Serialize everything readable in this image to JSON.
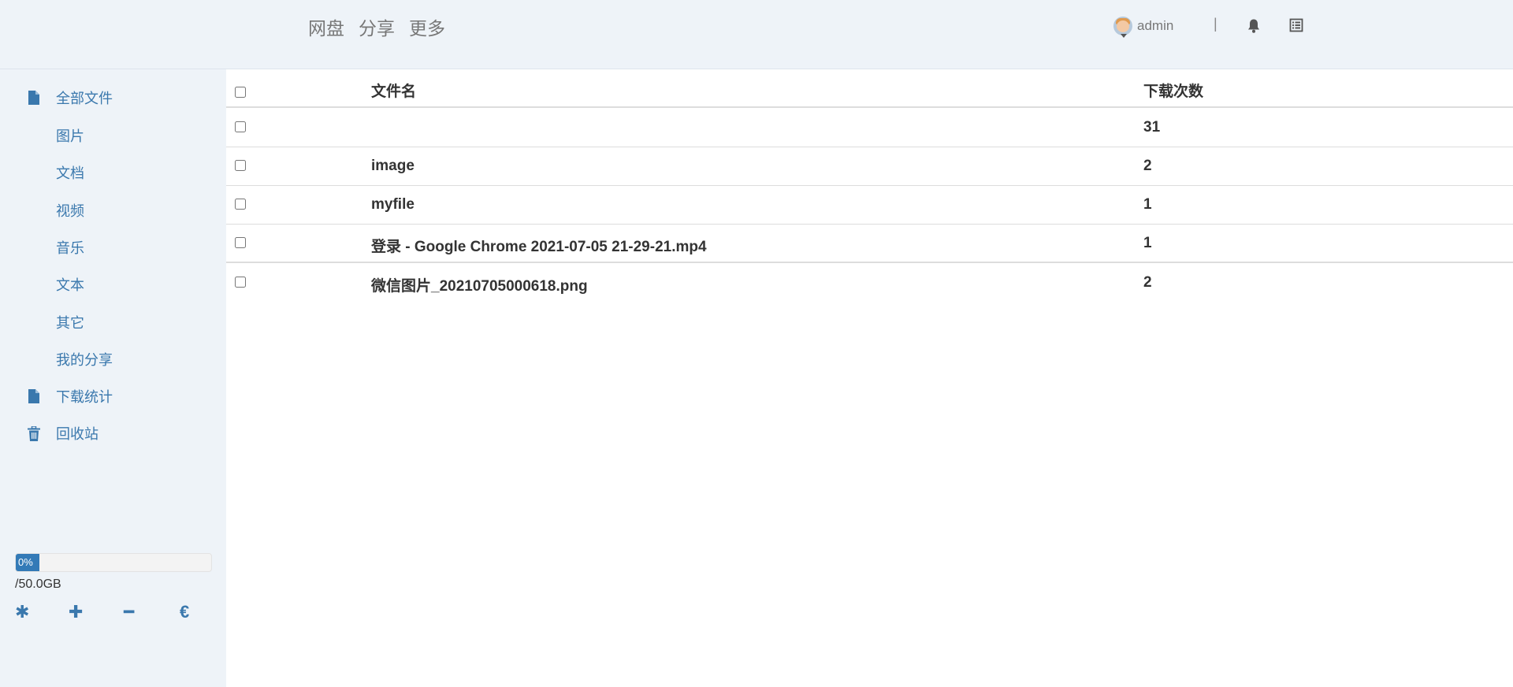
{
  "topnav": {
    "items": [
      "网盘",
      "分享",
      "更多"
    ]
  },
  "user": {
    "name": "admin",
    "separator": "|",
    "icons": [
      "avatar",
      "bell-icon",
      "list-icon"
    ]
  },
  "sidebar": {
    "items": [
      {
        "label": "全部文件",
        "icon": "file-icon"
      },
      {
        "label": "图片",
        "icon": ""
      },
      {
        "label": "文档",
        "icon": ""
      },
      {
        "label": "视频",
        "icon": ""
      },
      {
        "label": "音乐",
        "icon": ""
      },
      {
        "label": "文本",
        "icon": ""
      },
      {
        "label": "其它",
        "icon": ""
      },
      {
        "label": "我的分享",
        "icon": ""
      },
      {
        "label": "下载统计",
        "icon": "file-icon"
      },
      {
        "label": "回收站",
        "icon": "trash-icon"
      }
    ],
    "storage": {
      "percent_label": "0%",
      "used_fraction": 0,
      "quota_text": "/50.0GB"
    },
    "tools": [
      {
        "glyph": "✱",
        "icon": "asterisk-icon"
      },
      {
        "glyph": "✚",
        "icon": "plus-icon"
      },
      {
        "glyph": "━",
        "icon": "minus-icon"
      },
      {
        "glyph": "€",
        "icon": "euro-icon"
      }
    ]
  },
  "table": {
    "columns": {
      "name": "文件名",
      "downloads": "下载次数"
    },
    "rows": [
      {
        "name": "",
        "downloads": "31"
      },
      {
        "name": "image",
        "downloads": "2"
      },
      {
        "name": "myfile",
        "downloads": "1"
      },
      {
        "name": "登录 - Google Chrome 2021-07-05 21-29-21.mp4",
        "downloads": "1"
      },
      {
        "name": "微信图片_20210705000618.png",
        "downloads": "2"
      }
    ]
  },
  "colors": {
    "accent": "#337ab7",
    "link": "#3a78ad",
    "background": "#eef3f8"
  }
}
